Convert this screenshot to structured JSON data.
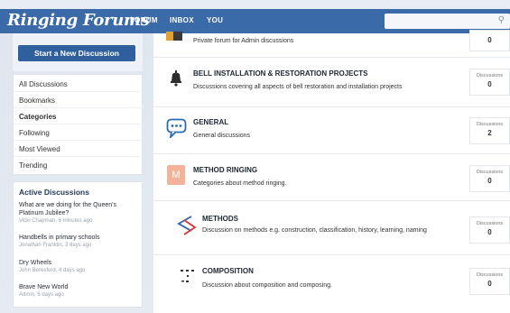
{
  "header": {
    "logo": "Ringing Forums",
    "nav": [
      "FORUM",
      "INBOX",
      "YOU"
    ]
  },
  "sidebar": {
    "start_button": "Start a New Discussion",
    "menu": [
      "All Discussions",
      "Bookmarks",
      "Categories",
      "Following",
      "Most Viewed",
      "Trending"
    ],
    "active_menu_item": "Categories",
    "active_title": "Active Discussions",
    "discussions": [
      {
        "title": "What are we doing for the Queen's Platinum Jubilee?",
        "meta": "Vicki Chapman, 6 minutes ago"
      },
      {
        "title": "Handbells in primary schools",
        "meta": "Jonathan Franklin, 3 days ago"
      },
      {
        "title": "Dry Wheels",
        "meta": "John Beresford, 4 days ago"
      },
      {
        "title": "Brave New World",
        "meta": "Admin, 6 days ago"
      }
    ]
  },
  "categories": [
    {
      "title": "",
      "description": "Private forum for Admin discussions",
      "count_label": "",
      "count": "0",
      "icon": "folder-icon"
    },
    {
      "title": "BELL INSTALLATION & RESTORATION PROJECTS",
      "description": "Discussions covering all aspects of bell restoration and installation projects",
      "count_label": "Discussions",
      "count": "0",
      "icon": "bell-icon"
    },
    {
      "title": "GENERAL",
      "description": "General discussions",
      "count_label": "Discussions",
      "count": "2",
      "icon": "chat-bubble-icon"
    },
    {
      "title": "METHOD RINGING",
      "description": "Categories about method ringing.",
      "count_label": "Discussions",
      "count": "0",
      "icon": "m-badge-icon"
    },
    {
      "title": "METHODS",
      "description": "Discussion on methods e.g. construction, classification, history, learning, naming",
      "count_label": "Discussions",
      "count": "0",
      "icon": "method-line-icon"
    },
    {
      "title": "COMPOSITION",
      "description": "Discussion about composition and composing.",
      "count_label": "Discussions",
      "count": "0",
      "icon": "composition-icon"
    }
  ],
  "icon_letter": "M",
  "colors": {
    "brand": "#3b6aa8",
    "button": "#2f5f9c",
    "m_badge": "#f2b39a",
    "methods_blue": "#2b63b8",
    "methods_red": "#d9343c"
  }
}
